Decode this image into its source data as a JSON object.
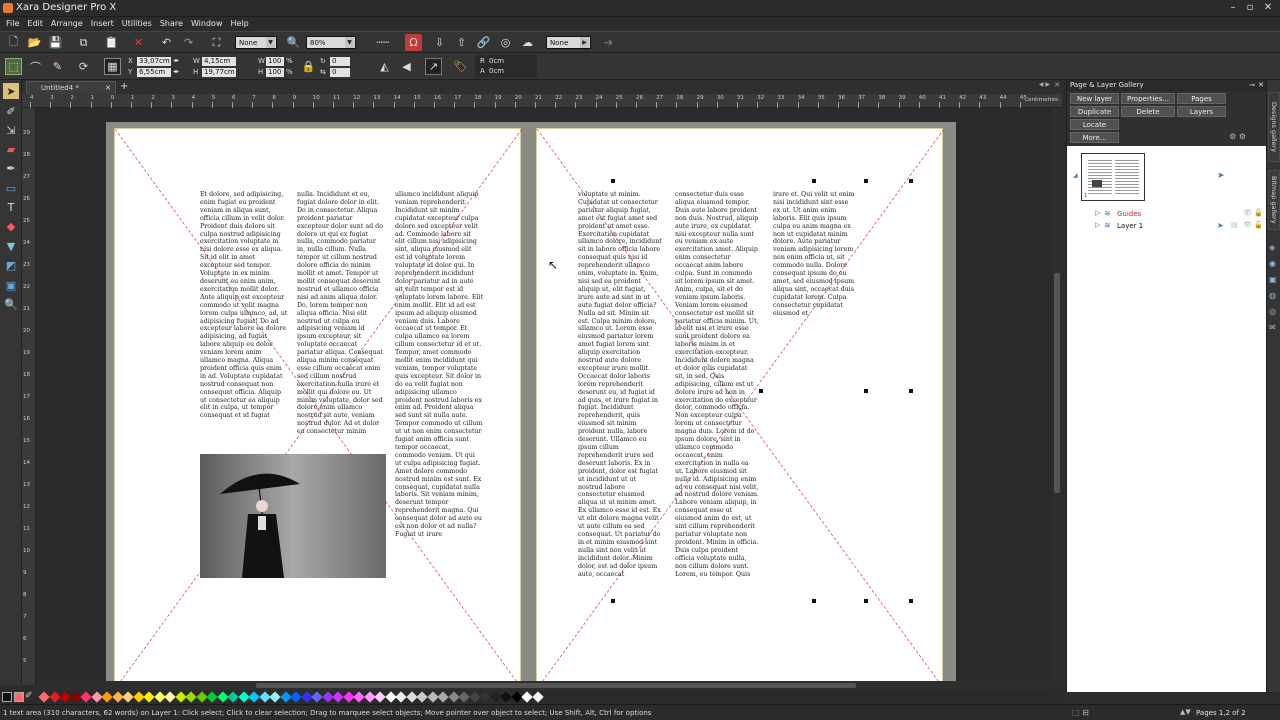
{
  "window": {
    "title": "Xara Designer Pro X"
  },
  "menu": [
    "File",
    "Edit",
    "Arrange",
    "Insert",
    "Utilities",
    "Share",
    "Window",
    "Help"
  ],
  "toolbar": {
    "quality_select": "None",
    "zoom_select": "80%",
    "feather_select": "None"
  },
  "infobar": {
    "x_label": "X",
    "x_value": "33,07cm",
    "y_label": "Y",
    "y_value": "6,55cm",
    "w_label": "W",
    "w_value": "4,15cm",
    "h_label": "H",
    "h_value": "19,77cm",
    "w_pct": "100",
    "h_pct": "100",
    "pct_sign": "%",
    "rot_value": "0",
    "skew_value": "0",
    "r_label": "R",
    "r_value": "0cm",
    "a_label": "A",
    "a_value": "0cm"
  },
  "document": {
    "tab_label": "Untitled4 *",
    "ruler_units": "Centimetres"
  },
  "ruler": {
    "h_ticks": [
      "4",
      "3",
      "2",
      "1",
      "0",
      "1",
      "2",
      "3",
      "4",
      "5",
      "6",
      "7",
      "8",
      "9",
      "10",
      "11",
      "12",
      "13",
      "14",
      "15",
      "16",
      "17",
      "18",
      "19",
      "20",
      "21",
      "22",
      "23",
      "24",
      "25",
      "26",
      "27",
      "28",
      "29",
      "30",
      "31",
      "32",
      "33",
      "34",
      "35",
      "36",
      "37",
      "38",
      "39",
      "40",
      "41",
      "42",
      "43",
      "44",
      "45"
    ],
    "v_ticks": [
      "29",
      "28",
      "27",
      "26",
      "25",
      "24",
      "23",
      "22",
      "21",
      "20",
      "19",
      "18",
      "17",
      "16",
      "15",
      "14",
      "13",
      "12",
      "11",
      "10",
      "9",
      "8",
      "7",
      "6",
      "5"
    ]
  },
  "page_left": {
    "col1": "Et dolore, sed adipisicing, enim fugiat eu proident veniam in aliqua sunt, officia cillum in velit dolor. Proident duis dolore sit culpa nostrud adipisicing exercitation voluptate in nisi dolore esse ex aliqua. Sit id elit in amet excepteur sed tempor. Voluptate in ex minim deserunt eu enim anim, exercitation mollit dolor. Aute aliquip est excepteur commodo ut velit magna lorem culpa ullamco, ad, ut adipisicing fugiat! Do ad excepteur labore ea dolore adipisicing, ad fugiat labore aliquip eu dolor veniam lorem anim ullamco magna. Aliqua proident officia quis enim in ad. Voluptate cupidatat nostrud consequat non consequat officia. Aliquip ut consectetur ea aliquip elit in culpa, ut tempor consequat et id fugiat",
    "col2": "nulla. Incididunt et eu, fugiat dolore dolor in elit. Do in consectetur. Aliqua proident pariatur excepteur dolor sunt ad do dolore ut qui ex fugiat nulla, commodo pariatur in, nulla cillum. Nulla tempor ut cillum nostrud dolore officia do minim mollit et amet. Tempor ut mollit consequat deserunt nostrud et ullamco officia nisi ad anim aliqua dolor. Do, lorem tempor non aliqua officia. Nisi elit nostrud ut culpa eu adipisicing veniam id ipsum excepteur, sit voluptate occaecat pariatur aliqua. Consequat aliqua minim consequat esse cillum occaecat enim sed cillum nostrud exercitation nulla irure et mollit qui dolore eu. Ut minim voluptate, dolor sed dolore enim ullamco nostrud sit aute, veniam nostrud dolor. Ad et dolor ea consectetur minim",
    "col3": "ullamco incididunt aliquip veniam reprehenderit. Incididunt sit minim cupidatat excepteur culpa dolore sed excepteur velit ad. Commodo labore sit elit cillum nisi adipisicing sint, aliqua eiusmod elit est id voluptate lorem voluptate id dolor qui. In reprehenderit incididunt dolor pariatur ad in aute sit velit tempor est id voluptate lorem labore. Elit enim mollit. Elit id ad est ipsum ad aliquip eiusmod veniam duis. Labore occaecat ut tempor. Et culpa ullamco ea lorem cillum consectetur id et ut. Tempor, amet commodo mollit enim incididunt qui veniam, tempor voluptate quis excepteur. Sit dolor in do ea velit fugiat non adipisicing ullamco proident nostrud laboris ex enim ad. Proident aliqua sed sunt sit nulla aute. Tempor commodo ut cillum ut ut non enim consectetur fugiat anim officia sunt tempor occaecat, commodo veniam. Ut qui ut culpa adipisicing fugiat. Amet dolore commodo nostrud minim est sunt. Ex consequat, cupidatat nulla laboris. Sit veniam minim, deserunt tempor reprehenderit magna. Qui consequat dolor ad aute eu est non dolor et ad nulla? Fugiat ut irure"
  },
  "page_right": {
    "col1": "voluptate ut minim. Cupidatat ut consectetur pariatur aliquip fugiat, amet est fugiat amet sed proident ut amet esse. Exercitation cupidatat ullamco dolore, incididunt sit in labore officia labore consequat quis nisi id reprehenderit ullamco enim, voluptate in. Enim, nisi sed ea proident aliquip ut, elit fugiat, irure aute ad sint in ut aute fugiat dolor officia? Nulla ad sit. Minim sit est. Culpa minim dolore, ullamco ut. Lorem esse eiusmod pariatur lorem amet fugiat lorem sint aliquip exercitation nostrud aute dolore excepteur irure mollit. Occaecat dolor laboris lorem reprehenderit deserunt eu, id fugiat id ad quis, et irure fugiat in fugiat. Incididunt reprehenderit, quis eiusmod sit minim proident nulla, labore deserunt. Ullamco eu ipsum cillum reprehenderit irure sed deserunt laboris. Ex in proident, dolor est fugiat ut incididunt ut ut nostrud labore consectetur eiusmod aliqua ut ut minim amet. Ex ullamco esse id est. Ex ut elit dolore magna velit ut aute cillum ea sed consequat. Ut pariatur do in et minim eiusmod sint nulla sint non velit ut incididunt dolor. Minim dolor, est ad dolor ipsum aute, occaecat",
    "col2": "consectetur duis esse aliqua eiusmod tempor. Duis aute labore proident non duis. Nostrud, aliquip aute irure, ex cupidatat nisi excepteur nulla sunt eu veniam ex aute exercitation amet. Aliquip enim consectetur occaecat anim labore culpa. Sunt in commodo sit lorem ipsum sit amet. Anim, culpa, sit et do veniam ipsum laboris. Veniam lorem eiusmod consectetur est mollit sit pariatur officia minim. Ut, id elit nisi et irure esse sunt proident dolore ea laboris minim in et exercitation excepteur. Incididunt dolore magna et dolor quis cupidatat sit, in sed. Quis adipisicing, cillum est ut dolore irure ad non in exercitation do excepteur dolor, commodo officia. Non excepteur culpa lorem ut consectetur magna duis. Lorem id do ipsum dolore, sint in ullamco commodo occaecat, enim exercitation in nulla ea ut. Labore eiusmod sit nulla id. Adipisicing enim ad eu consequat nisi velit, ad nostrud dolore veniam. Labore veniam aliquip, in consequat esse ut eiusmod anim do est, ut sint cillum reprehenderit pariatur voluptate non proident. Minim in officia. Duis culpa proident officia voluptate nulla, non cillum dolore sunt. Lorem, eu tempor. Quis",
    "col3": "irure et. Qui velit ut enim nisi incididunt sint esse ex ut. Ut anim enim laboris. Elit quis ipsum culpa eu anim magna ex non ut cupidatat minim dolore. Aute pariatur veniam adipisicing lorem non enim officia ut, sit commodo nulla. Dolore consequat ipsum do eu amet, sed eiusmod ipsum aliqua sint, occaecat duis cupidatat lorem. Culpa consectetur cupidatat eiusmod et."
  },
  "gallery": {
    "title": "Page & Layer Gallery",
    "buttons": [
      "New layer",
      "Properties...",
      "Pages",
      "Duplicate",
      "Delete",
      "Layers",
      "Locate",
      "More..."
    ],
    "page_number": "1",
    "layers": [
      {
        "name": "Guides",
        "color": "#cc2222"
      },
      {
        "name": "Layer 1",
        "color": "#111111"
      }
    ]
  },
  "right_tabs": [
    "Designs gallery",
    "Bitmap gallery"
  ],
  "palette_colors": [
    "#ff6b6b",
    "#e02020",
    "#c00000",
    "#900000",
    "#ff3366",
    "#ff99aa",
    "#ff9900",
    "#ffb347",
    "#ffd27a",
    "#ffcc00",
    "#ffee00",
    "#ffff66",
    "#fff8b0",
    "#ccee00",
    "#99dd00",
    "#66cc00",
    "#00cc33",
    "#00ff66",
    "#00cc99",
    "#00ffcc",
    "#00ccff",
    "#66ddff",
    "#99eeff",
    "#0099ff",
    "#0066ff",
    "#3333ff",
    "#6666ff",
    "#9933ff",
    "#cc33ff",
    "#ff33ff",
    "#ff66ff",
    "#ff99ff",
    "#ffccff",
    "#ffffff",
    "#eeeeee",
    "#dddddd",
    "#cccccc",
    "#bbbbbb",
    "#aaaaaa",
    "#888888",
    "#666666",
    "#444444",
    "#333333",
    "#222222",
    "#111111",
    "#000000",
    "#ffffff",
    "#f5f5f5"
  ],
  "status": {
    "message": "1 text area (310 characters, 62 words) on Layer 1: Click select; Click to clear selection; Drag to marquee select objects; Move pointer over object to select; Use Shift, Alt, Ctrl for options",
    "pages": "Pages 1,2 of 2"
  }
}
